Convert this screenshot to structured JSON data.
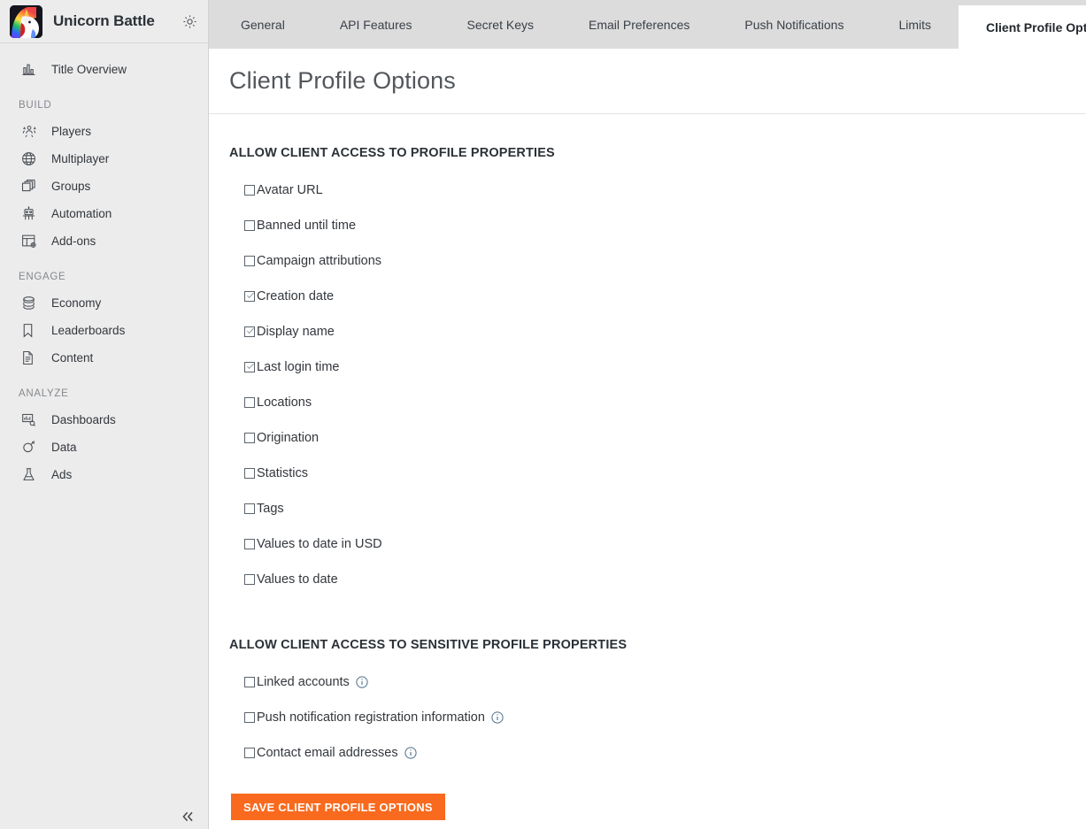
{
  "brand": {
    "app_title": "Unicorn Battle",
    "logo_icon": "unicorn-logo-icon",
    "settings_icon": "gear-icon",
    "colors": {
      "sidebar_bg": "#ececec",
      "tabbar_bg": "#dcdcdc",
      "content_bg": "#ffffff",
      "accent_orange": "#f96a1e",
      "text_dark": "#2b3137",
      "text_muted": "#84888c",
      "info_icon": "#4a6b8a"
    }
  },
  "sidebar": {
    "overview": {
      "label": "Title Overview",
      "icon": "bar-chart-icon"
    },
    "groups": [
      {
        "label": "BUILD",
        "items": [
          {
            "label": "Players",
            "icon": "players-icon"
          },
          {
            "label": "Multiplayer",
            "icon": "globe-icon"
          },
          {
            "label": "Groups",
            "icon": "layers-icon"
          },
          {
            "label": "Automation",
            "icon": "robot-icon"
          },
          {
            "label": "Add-ons",
            "icon": "addons-icon"
          }
        ]
      },
      {
        "label": "ENGAGE",
        "items": [
          {
            "label": "Economy",
            "icon": "coins-stack-icon"
          },
          {
            "label": "Leaderboards",
            "icon": "bookmark-icon"
          },
          {
            "label": "Content",
            "icon": "document-icon"
          }
        ]
      },
      {
        "label": "ANALYZE",
        "items": [
          {
            "label": "Dashboards",
            "icon": "dashboard-search-icon"
          },
          {
            "label": "Data",
            "icon": "data-plug-icon"
          },
          {
            "label": "Ads",
            "icon": "flask-icon"
          }
        ]
      }
    ],
    "collapse": {
      "icon": "chevron-double-left-icon",
      "label": ""
    }
  },
  "tabs": [
    {
      "label": "General",
      "active": false
    },
    {
      "label": "API Features",
      "active": false
    },
    {
      "label": "Secret Keys",
      "active": false
    },
    {
      "label": "Email Preferences",
      "active": false
    },
    {
      "label": "Push Notifications",
      "active": false
    },
    {
      "label": "Limits",
      "active": false
    },
    {
      "label": "Client Profile Options",
      "active": true
    }
  ],
  "page": {
    "title": "Client Profile Options"
  },
  "sections": [
    {
      "heading": "ALLOW CLIENT ACCESS TO PROFILE PROPERTIES",
      "options": [
        {
          "label": "Avatar URL",
          "checked": false,
          "info": false
        },
        {
          "label": "Banned until time",
          "checked": false,
          "info": false
        },
        {
          "label": "Campaign attributions",
          "checked": false,
          "info": false
        },
        {
          "label": "Creation date",
          "checked": true,
          "info": false
        },
        {
          "label": "Display name",
          "checked": true,
          "info": false
        },
        {
          "label": "Last login time",
          "checked": true,
          "info": false
        },
        {
          "label": "Locations",
          "checked": false,
          "info": false
        },
        {
          "label": "Origination",
          "checked": false,
          "info": false
        },
        {
          "label": "Statistics",
          "checked": false,
          "info": false
        },
        {
          "label": "Tags",
          "checked": false,
          "info": false
        },
        {
          "label": "Values to date in USD",
          "checked": false,
          "info": false
        },
        {
          "label": "Values to date",
          "checked": false,
          "info": false
        }
      ]
    },
    {
      "heading": "ALLOW CLIENT ACCESS TO SENSITIVE PROFILE PROPERTIES",
      "options": [
        {
          "label": "Linked accounts",
          "checked": false,
          "info": true
        },
        {
          "label": "Push notification registration information",
          "checked": false,
          "info": true
        },
        {
          "label": "Contact email addresses",
          "checked": false,
          "info": true
        }
      ]
    }
  ],
  "actions": {
    "save_label": "SAVE CLIENT PROFILE OPTIONS"
  }
}
